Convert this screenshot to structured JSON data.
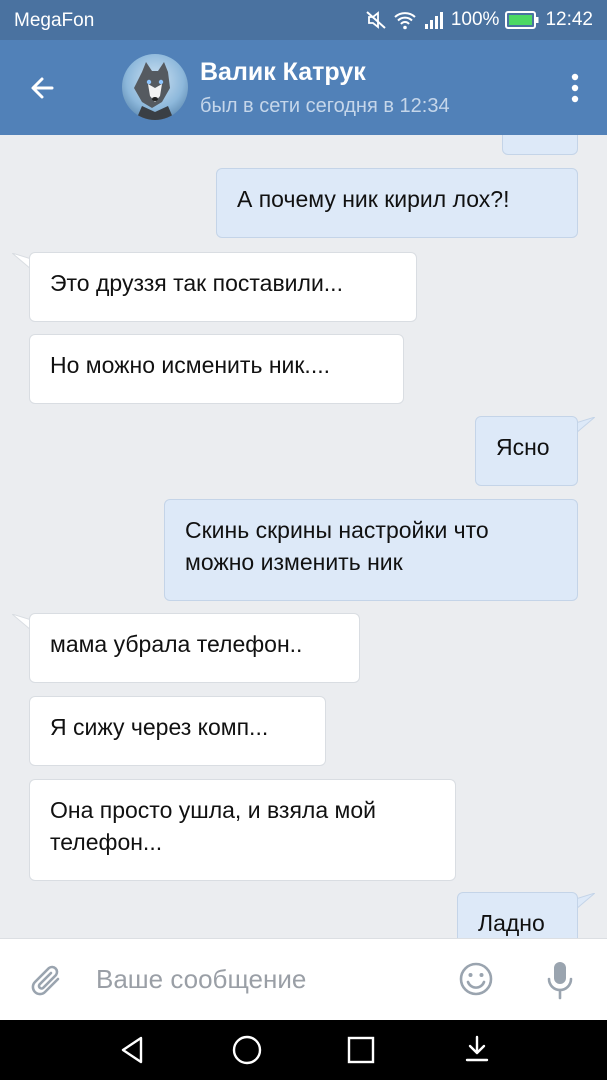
{
  "status_bar": {
    "carrier": "MegaFon",
    "battery": "100%",
    "time": "12:42"
  },
  "header": {
    "name": "Валик Катрук",
    "status": "был в сети сегодня в 12:34"
  },
  "messages": [
    {
      "dir": "out",
      "text": ""
    },
    {
      "dir": "out",
      "text": "А почему ник кирил лох?!"
    },
    {
      "dir": "in",
      "text": "Это друззя так поставили..."
    },
    {
      "dir": "in",
      "text": "Но можно исменить ник...."
    },
    {
      "dir": "out",
      "text": "Ясно"
    },
    {
      "dir": "out",
      "text": "Скинь скрины настройки что можно изменить ник"
    },
    {
      "dir": "in",
      "text": "мама убрала телефон.."
    },
    {
      "dir": "in",
      "text": "Я сижу через комп..."
    },
    {
      "dir": "in",
      "text": "Она просто ушла, и взяла мой телефон..."
    },
    {
      "dir": "out",
      "text": "Ладно"
    }
  ],
  "input": {
    "placeholder": "Ваше сообщение"
  },
  "colors": {
    "header": "#5181b8",
    "status_bar": "#4a72a0",
    "chat_background": "#ebedf0",
    "incoming_bubble": "#ffffff",
    "outgoing_bubble": "#dde9f8"
  },
  "icons": [
    "back-arrow-icon",
    "more-vert-icon",
    "attach-icon",
    "emoji-icon",
    "mic-icon",
    "nav-back-icon",
    "nav-home-icon",
    "nav-recents-icon",
    "nav-notifications-icon"
  ]
}
